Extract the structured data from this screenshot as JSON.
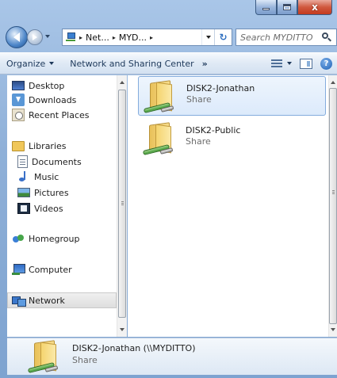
{
  "window": {
    "close_glyph": "x"
  },
  "address_bar": {
    "crumbs": [
      "Net...",
      "MYD..."
    ],
    "separator": "▸",
    "refresh_glyph": "↻"
  },
  "search": {
    "placeholder": "Search MYDITTO"
  },
  "toolbar": {
    "organize_label": "Organize",
    "network_center_label": "Network and Sharing Center",
    "more_label": "»",
    "help_label": "?"
  },
  "nav_pane": {
    "items": [
      {
        "label": "Desktop",
        "icon": "desktop-icon"
      },
      {
        "label": "Downloads",
        "icon": "downloads-icon"
      },
      {
        "label": "Recent Places",
        "icon": "recent-places-icon"
      },
      {
        "label": "Libraries",
        "icon": "libraries-icon"
      },
      {
        "label": "Documents",
        "icon": "documents-icon"
      },
      {
        "label": "Music",
        "icon": "music-icon"
      },
      {
        "label": "Pictures",
        "icon": "pictures-icon"
      },
      {
        "label": "Videos",
        "icon": "videos-icon"
      },
      {
        "label": "Homegroup",
        "icon": "homegroup-icon"
      },
      {
        "label": "Computer",
        "icon": "computer-icon"
      },
      {
        "label": "Network",
        "icon": "network-icon",
        "selected": true
      }
    ]
  },
  "content": {
    "shares": [
      {
        "name": "DISK2-Jonathan",
        "type": "Share",
        "selected": true
      },
      {
        "name": "DISK2-Public",
        "type": "Share",
        "selected": false
      }
    ]
  },
  "details": {
    "name": "DISK2-Jonathan (\\\\MYDITTO)",
    "type": "Share"
  },
  "colors": {
    "selection_border": "#84acdd",
    "selection_fill": "#dceafb",
    "toolbar_text": "#1e395b",
    "window_frame": "#8fb0d8"
  }
}
